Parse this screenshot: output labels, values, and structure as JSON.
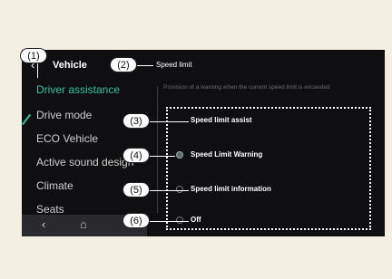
{
  "header": {
    "title": "Vehicle",
    "back_icon": "back-arrow-icon"
  },
  "setting": {
    "title": "Speed limit",
    "description": "Provision of a warning when the current speed limit is exceeded"
  },
  "sidebar": {
    "items": [
      {
        "label": "Driver assistance",
        "active": true
      },
      {
        "label": "Drive mode"
      },
      {
        "label": "ECO Vehicle"
      },
      {
        "label": "Active sound design"
      },
      {
        "label": "Climate"
      },
      {
        "label": "Seats"
      }
    ],
    "accent_color": "#2fc3a5"
  },
  "bottom_bar": {
    "back_icon": "chevron-left-icon",
    "home_icon": "home-icon"
  },
  "options": [
    {
      "label": "Speed limit assist"
    },
    {
      "label": "Speed Limit Warning",
      "selected": true
    },
    {
      "label": "Speed limit information"
    },
    {
      "label": "Off"
    }
  ],
  "callouts": [
    "(1)",
    "(2)",
    "(3)",
    "(4)",
    "(5)",
    "(6)"
  ]
}
